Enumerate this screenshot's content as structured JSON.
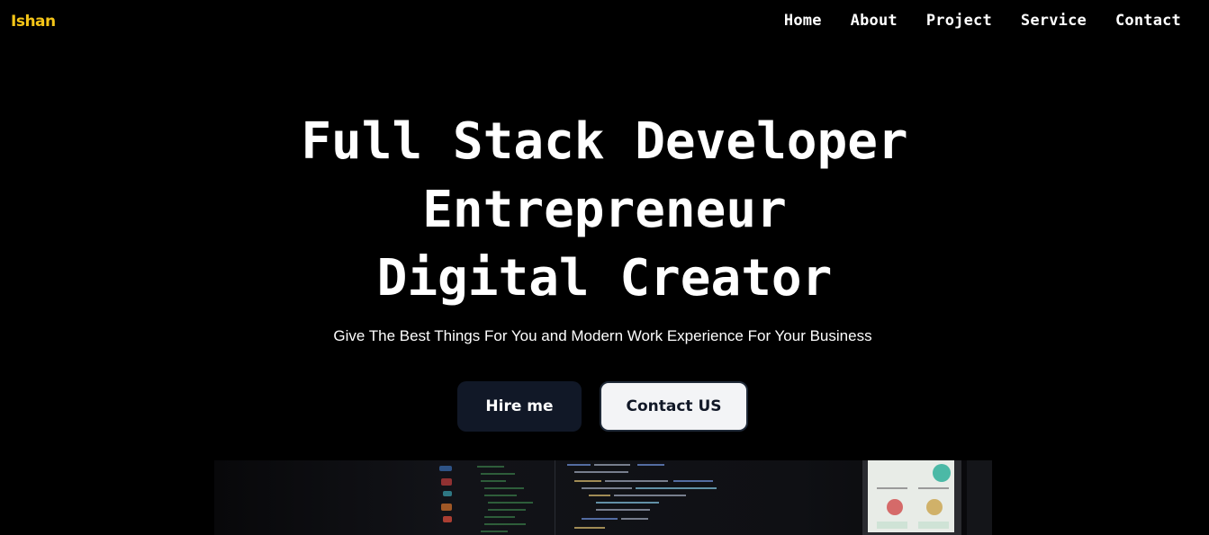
{
  "nav": {
    "logo": "Ishan",
    "links": [
      "Home",
      "About",
      "Project",
      "Service",
      "Contact"
    ]
  },
  "hero": {
    "lines": [
      "Full Stack Developer",
      "Entrepreneur",
      "Digital Creator"
    ],
    "subtitle": "Give The Best Things For You and Modern Work Experience For Your Business",
    "buttons": {
      "hire": "Hire me",
      "contact": "Contact US"
    }
  },
  "colors": {
    "background": "#000000",
    "logo": "#f5c518",
    "hire_button": "#111827",
    "contact_button": "#f3f4f6"
  }
}
